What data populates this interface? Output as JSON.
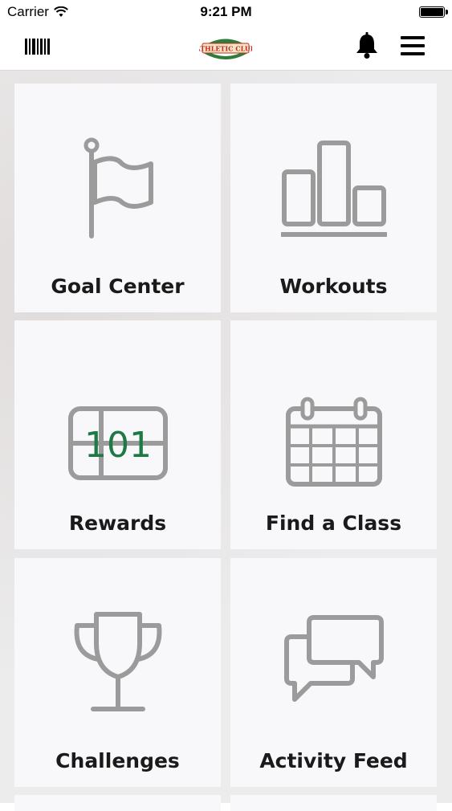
{
  "status_bar": {
    "carrier": "Carrier",
    "time": "9:21 PM",
    "icons": [
      "wifi-icon",
      "battery-icon"
    ]
  },
  "nav_bar": {
    "logo_text": "ATHLETIC CLUB",
    "icons": [
      "barcode-icon",
      "bell-icon",
      "hamburger-menu-icon"
    ]
  },
  "tiles": [
    {
      "label": "Goal Center",
      "icon": "flag-icon"
    },
    {
      "label": "Workouts",
      "icon": "bar-chart-icon"
    },
    {
      "label": "Rewards",
      "icon": "scoreboard-icon",
      "icon_text": "101"
    },
    {
      "label": "Find a Class",
      "icon": "calendar-icon"
    },
    {
      "label": "Challenges",
      "icon": "trophy-icon"
    },
    {
      "label": "Activity Feed",
      "icon": "chat-bubbles-icon"
    }
  ],
  "colors": {
    "icon_gray": "#9b9b9b",
    "reward_green": "#1e7a45",
    "tile_bg": "#f8f8fa",
    "logo_red": "#c8281e",
    "logo_green": "#2f7d3a"
  }
}
